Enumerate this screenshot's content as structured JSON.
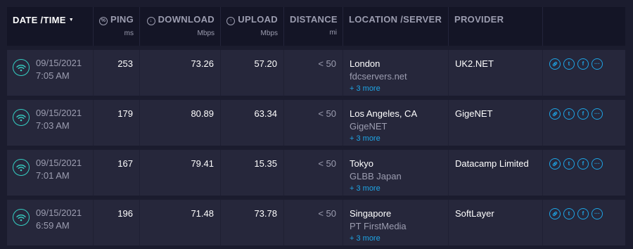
{
  "header": {
    "date_time": "DATE /TIME",
    "ping": "PING",
    "ping_unit": "ms",
    "download": "DOWNLOAD",
    "download_unit": "Mbps",
    "upload": "UPLOAD",
    "upload_unit": "Mbps",
    "distance": "DISTANCE",
    "distance_unit": "mi",
    "location": "LOCATION /SERVER",
    "provider": "PROVIDER"
  },
  "rows": [
    {
      "date": "09/15/2021",
      "time": "7:05 AM",
      "ping": "253",
      "download": "73.26",
      "upload": "57.20",
      "distance": "< 50",
      "city": "London",
      "server": "fdcservers.net",
      "more": "+ 3 more",
      "provider": "UK2.NET"
    },
    {
      "date": "09/15/2021",
      "time": "7:03 AM",
      "ping": "179",
      "download": "80.89",
      "upload": "63.34",
      "distance": "< 50",
      "city": "Los Angeles, CA",
      "server": "GigeNET",
      "more": "+ 3 more",
      "provider": "GigeNET"
    },
    {
      "date": "09/15/2021",
      "time": "7:01 AM",
      "ping": "167",
      "download": "79.41",
      "upload": "15.35",
      "distance": "< 50",
      "city": "Tokyo",
      "server": "GLBB Japan",
      "more": "+ 3 more",
      "provider": "Datacamp Limited"
    },
    {
      "date": "09/15/2021",
      "time": "6:59 AM",
      "ping": "196",
      "download": "71.48",
      "upload": "73.78",
      "distance": "< 50",
      "city": "Singapore",
      "server": "PT FirstMedia",
      "more": "+ 3 more",
      "provider": "SoftLayer"
    }
  ],
  "icons": {
    "header_ping": "ping-icon",
    "header_download": "download-arrow-icon",
    "header_upload": "upload-arrow-icon",
    "connection": "wifi-icon",
    "actions": [
      "link-icon",
      "twitter-icon",
      "facebook-icon",
      "more-options-icon"
    ]
  },
  "colors": {
    "background": "#1b1c2e",
    "header_background": "#141526",
    "row_background": "#26273b",
    "accent_blue": "#1ea5e6",
    "wifi_teal": "#35cfc3",
    "muted_text": "#9c9db0"
  }
}
